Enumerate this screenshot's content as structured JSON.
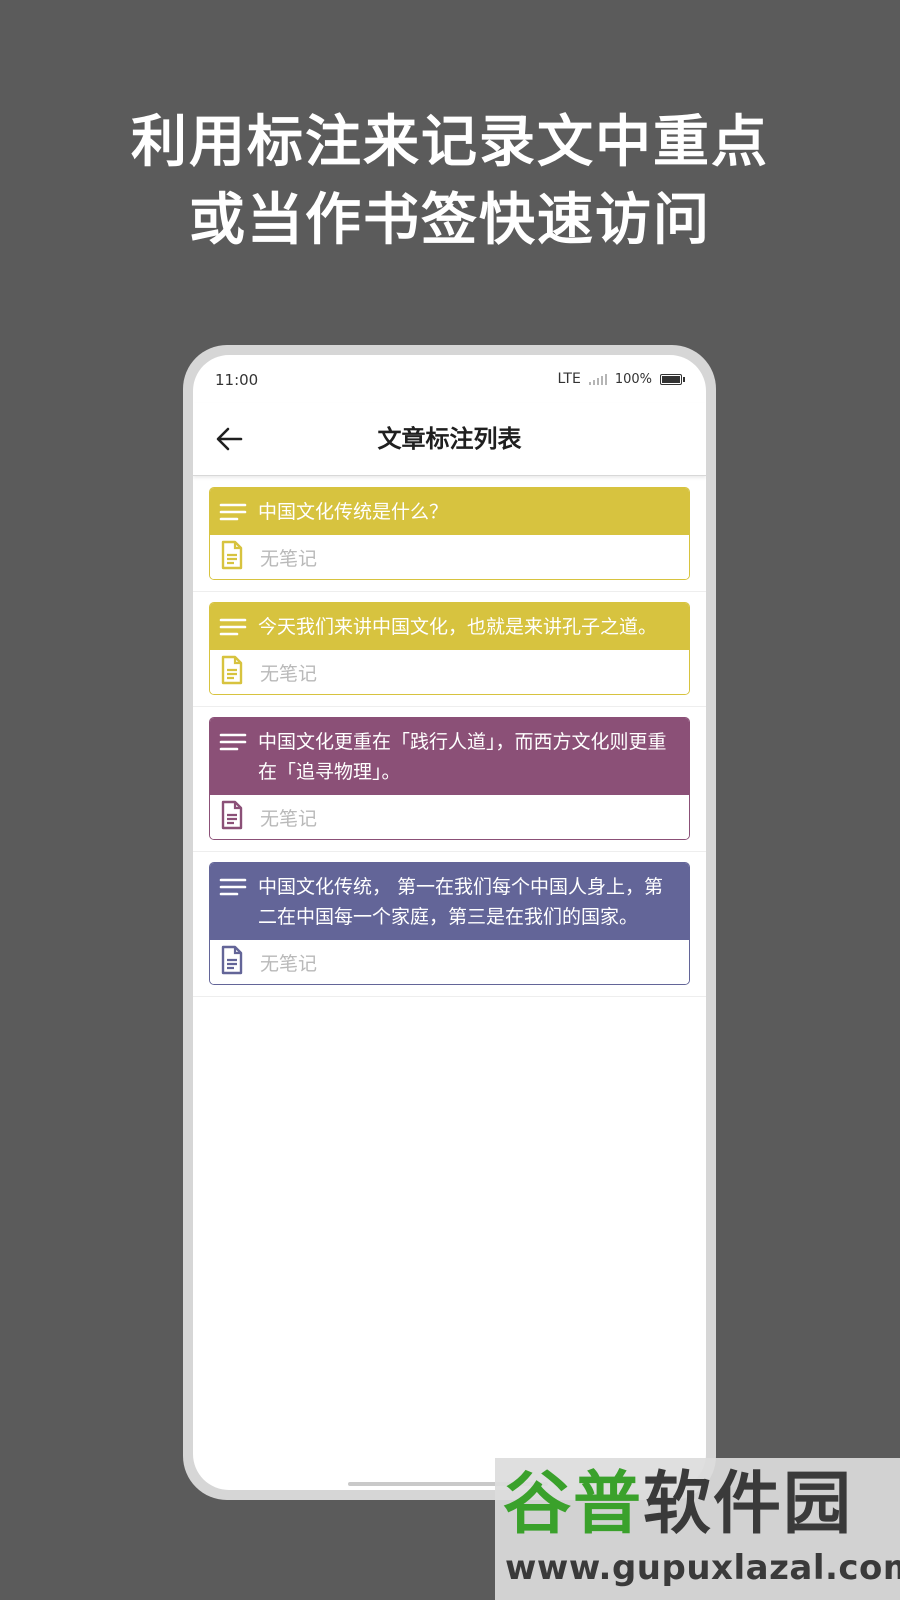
{
  "headline": {
    "line1": "利用标注来记录文中重点",
    "line2": "或当作书签快速访问"
  },
  "status_bar": {
    "time": "11:00",
    "network": "LTE",
    "battery": "100%"
  },
  "app_bar": {
    "back_icon": "arrow-left-icon",
    "title": "文章标注列表"
  },
  "annotations": [
    {
      "text": "中国文化传统是什么？",
      "note": "无笔记",
      "color": "#d7c33f"
    },
    {
      "text": "今天我们来讲中国文化，也就是来讲孔子之道。",
      "note": "无笔记",
      "color": "#d7c33f"
    },
    {
      "text": "中国文化更重在「践行人道」，而西方文化则更重在「追寻物理」。",
      "note": "无笔记",
      "color": "#8b5077"
    },
    {
      "text": "中国文化传统， 第一在我们每个中国人身上，第二在中国每一个家庭，第三是在我们的国家。",
      "note": "无笔记",
      "color": "#636598"
    }
  ],
  "watermark": {
    "brand": "谷普软件园",
    "url": "www.gupuxlazal.com"
  }
}
